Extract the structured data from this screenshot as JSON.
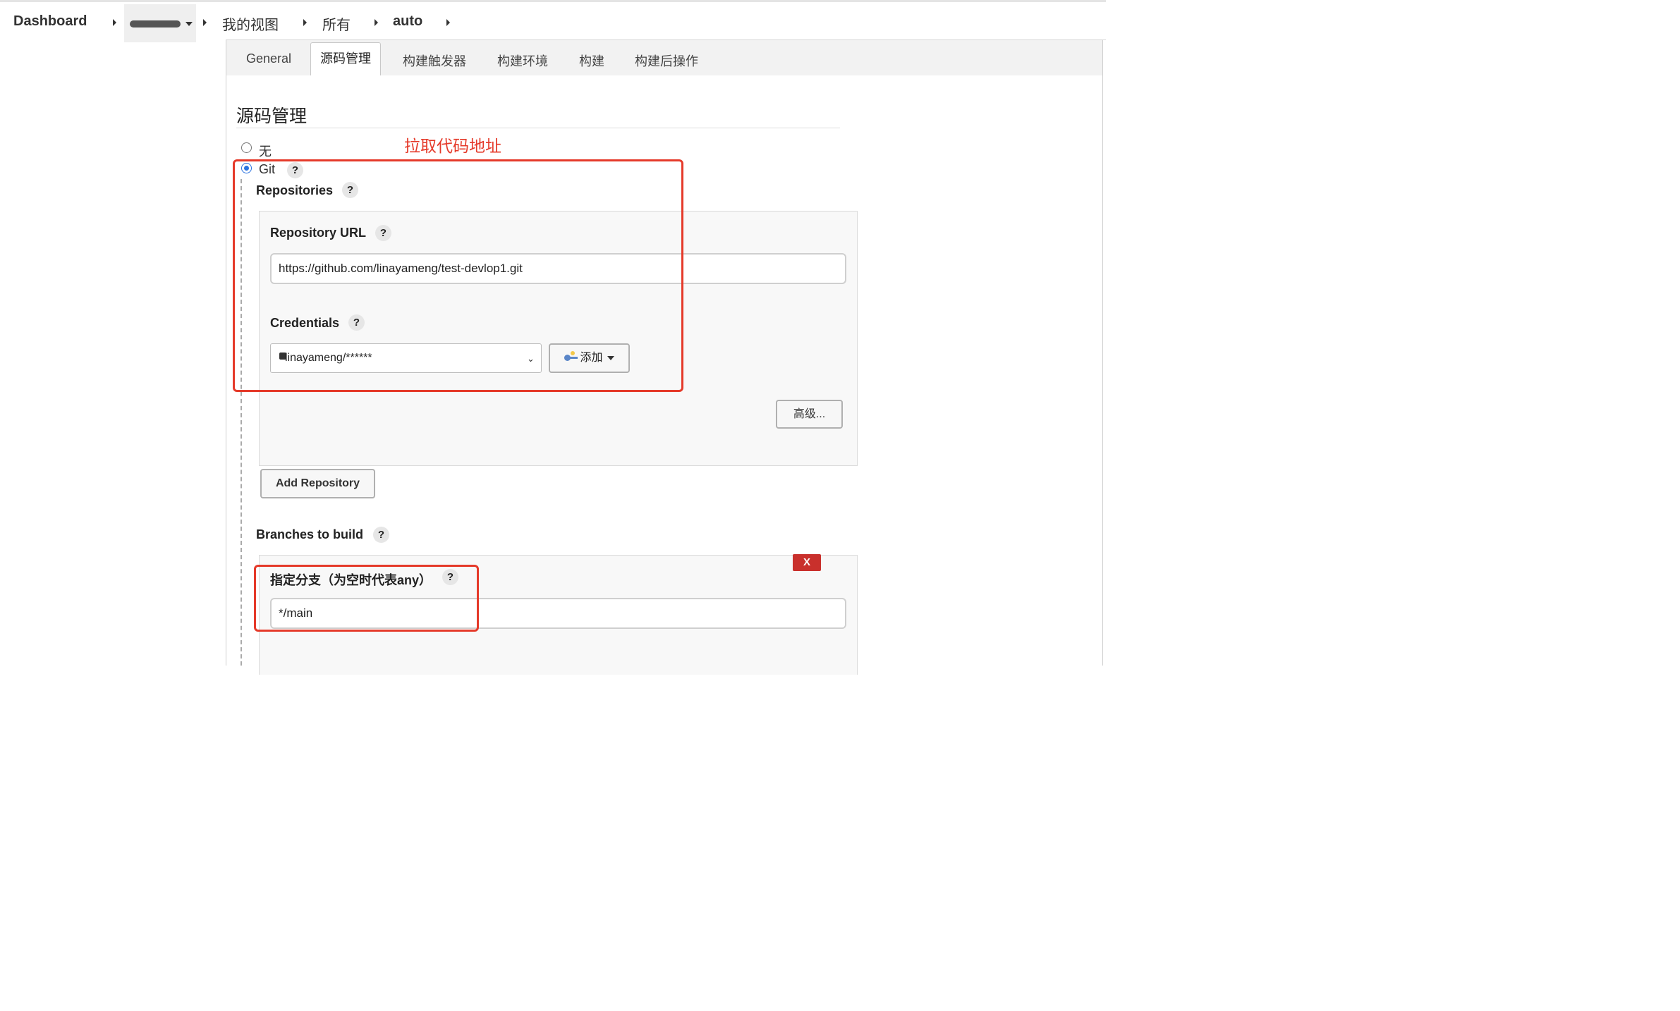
{
  "breadcrumb": {
    "items": [
      "Dashboard",
      "我的视图",
      "所有",
      "auto"
    ]
  },
  "tabs": [
    "General",
    "源码管理",
    "构建触发器",
    "构建环境",
    "构建",
    "构建后操作"
  ],
  "active_tab": "源码管理",
  "section_title": "源码管理",
  "scm": {
    "none_label": "无",
    "git_label": "Git",
    "selected": "Git"
  },
  "repositories": {
    "label": "Repositories",
    "url_label": "Repository URL",
    "url_value": "https://github.com/linayameng/test-devlop1.git",
    "credentials_label": "Credentials",
    "credentials_value": "linayameng/******",
    "add_label": "添加",
    "advanced_label": "高级...",
    "add_repository_label": "Add Repository"
  },
  "branches": {
    "label": "Branches to build",
    "delete_label": "X",
    "specifier_label": "指定分支（为空时代表any）",
    "specifier_value": "*/main"
  },
  "annotation": {
    "text": "拉取代码地址",
    "color": "#e53a2a"
  },
  "colors": {
    "radio_checked": "#2b73e0",
    "delete_button": "#c9302c"
  }
}
